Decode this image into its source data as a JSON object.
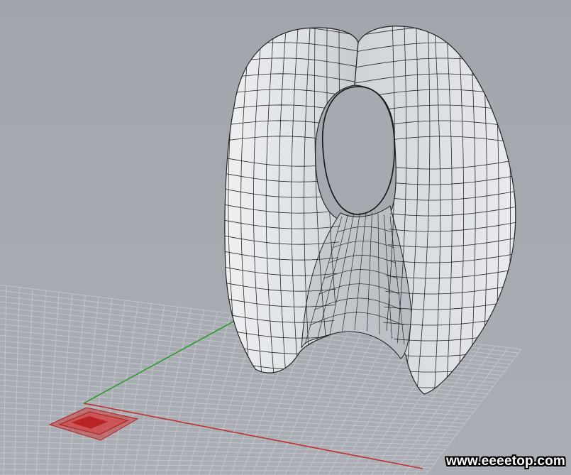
{
  "viewport": {
    "background": "#a6abb2",
    "grid_color": "#c4c8cd",
    "x_axis_color": "#c0302c",
    "y_axis_color": "#2f9a2f",
    "surface_fill": "#e3e5e8",
    "surface_mesh": "#1e1e1e",
    "gumball_color": "#cc2b2b"
  },
  "scene": {
    "object": "wireframe-surface-mesh"
  },
  "watermark": {
    "text": "www.eeeetop.com"
  }
}
